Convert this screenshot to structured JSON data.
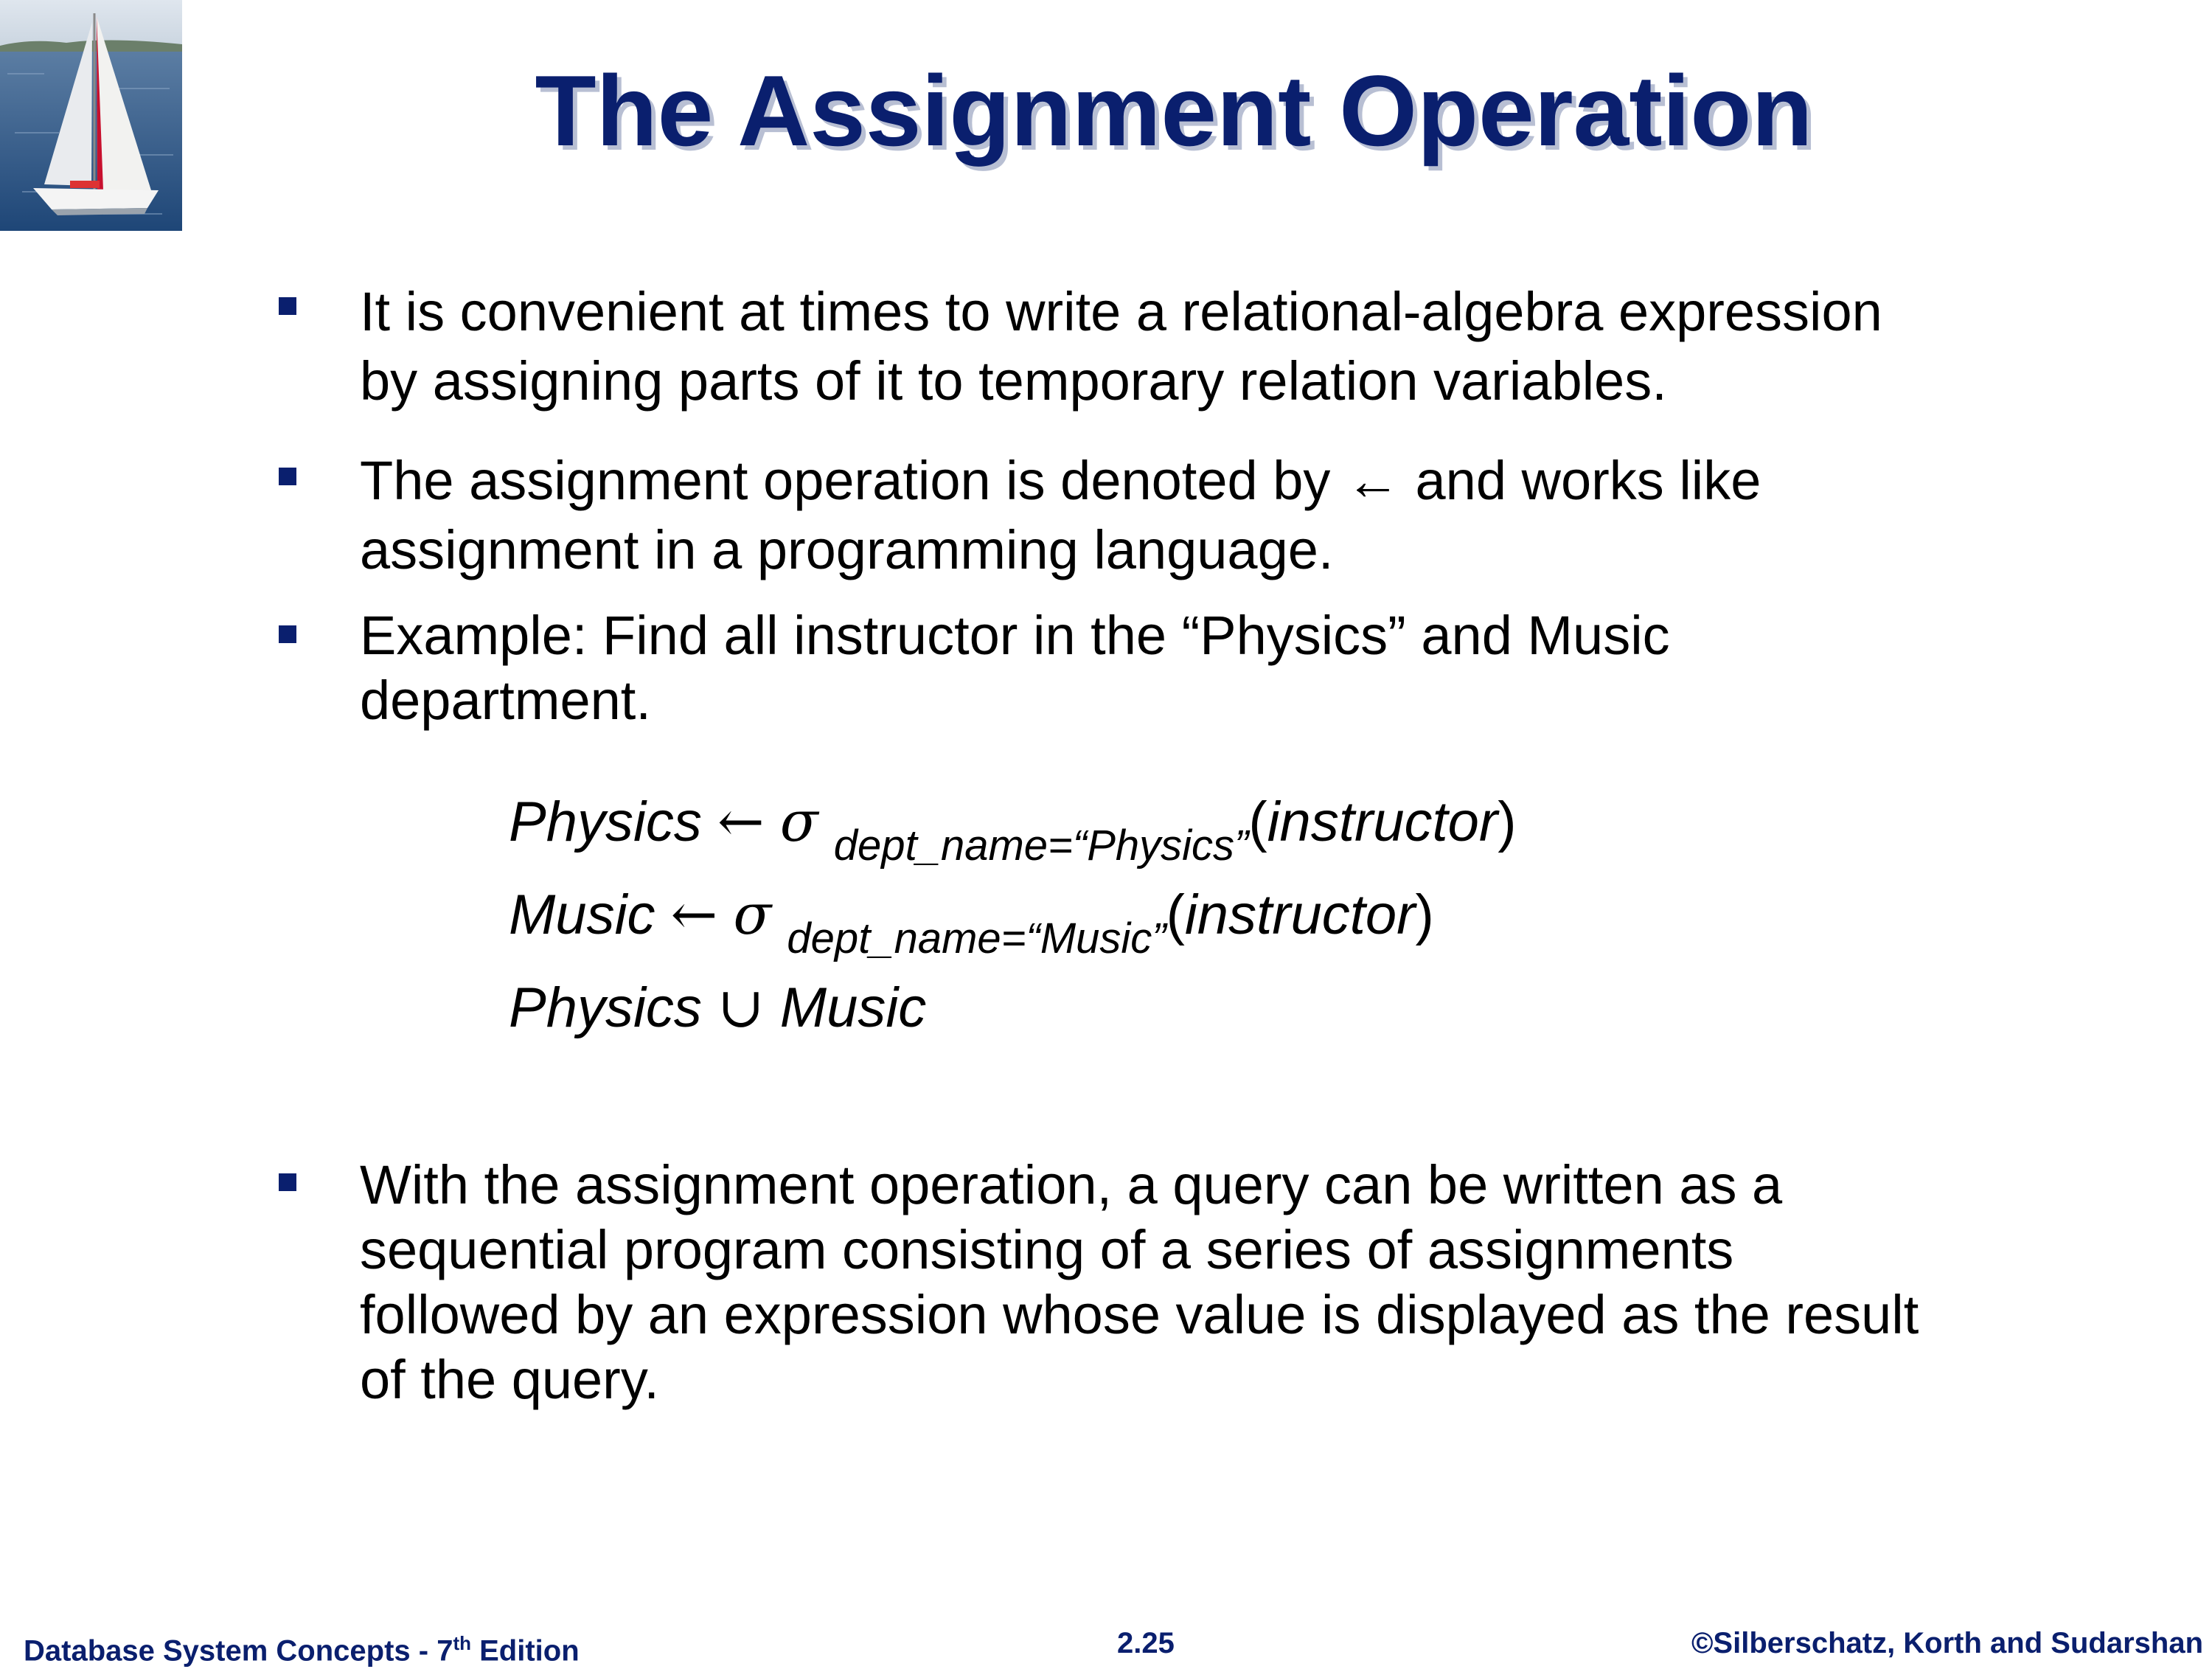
{
  "slide": {
    "title": "The Assignment  Operation"
  },
  "bullets": [
    {
      "lines": [
        "It is convenient at times to write a relational-algebra expression",
        "by assigning parts of it to temporary relation variables."
      ]
    },
    {
      "lines": [
        "The assignment  operation is  denoted by ← and works like",
        "assignment in a programming language."
      ]
    },
    {
      "lines": [
        "Example: Find all instructor in the “Physics” and Music",
        "department."
      ]
    },
    {
      "lines": [
        "With the assignment operation, a query can be written as a",
        "sequential program consisting of a series of assignments",
        "followed by an expression whose value is displayed as the result",
        "of the query."
      ]
    }
  ],
  "expressions": {
    "line1": {
      "lhs": "Physics",
      "arrow": "←",
      "sigma": "σ",
      "condition": "dept_name=“Physics”",
      "open": "(",
      "relation": "instructor",
      "close": ")"
    },
    "line2": {
      "lhs": "Music",
      "arrow": "←",
      "sigma": "σ",
      "condition": "dept_name=“Music”",
      "open": "(",
      "relation": "instructor",
      "close": ")"
    },
    "line3": {
      "left": "Physics",
      "union": "∪",
      "right": "Music"
    }
  },
  "footer": {
    "left_main": "Database System Concepts - 7",
    "left_sup": "th",
    "left_end": " Edition",
    "center": "2.25",
    "right": "©Silberschatz, Korth and Sudarshan"
  },
  "colors": {
    "title": "#0a1f6e",
    "bullet": "#0a1f6e",
    "footer": "#0a1f6e",
    "text": "#000000"
  },
  "icons": {
    "logo": "sailboat-image",
    "bullet": "square-bullet-icon"
  }
}
